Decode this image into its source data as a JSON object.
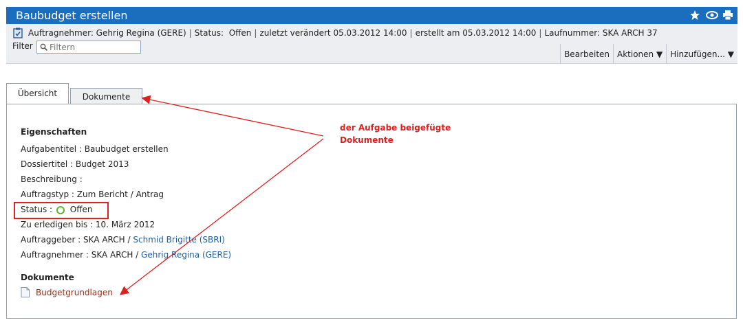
{
  "header": {
    "title": "Baubudget erstellen",
    "icons": [
      "star-icon",
      "eye-icon",
      "print-icon"
    ]
  },
  "meta": {
    "contractor": "Auftragnehmer: Gehrig Regina (GERE)",
    "status": "Status:  Offen",
    "modified": "zuletzt verändert 05.03.2012 14:00",
    "created": "erstellt am 05.03.2012 14:00",
    "number": "Laufnummer: SKA ARCH 37",
    "separator": "|"
  },
  "filter": {
    "label": "Filter",
    "placeholder": "Filtern"
  },
  "actions": [
    "Bearbeiten",
    "Aktionen ▼",
    "Hinzufügen... ▼"
  ],
  "tabs": {
    "overview": "Übersicht",
    "documents": "Dokumente"
  },
  "properties": {
    "heading": "Eigenschaften",
    "task_title": "Aufgabentitel : Baubudget erstellen",
    "dossier_title": "Dossiertitel : Budget 2013",
    "description": "Beschreibung :",
    "order_type": "Auftragstyp : Zum Bericht / Antrag",
    "status_label": "Status :",
    "status_value": "Offen",
    "due": "Zu erledigen bis : 10. März 2012",
    "issuer_prefix": "Auftraggeber : SKA ARCH /",
    "issuer_link": "Schmid Brigitte (SBRI)",
    "assignee_prefix": "Auftragnehmer : SKA ARCH /",
    "assignee_link": "Gehrig Regina (GERE)"
  },
  "documents": {
    "heading": "Dokumente",
    "items": [
      "Budgetgrundlagen"
    ]
  },
  "annotation": {
    "line1": "der Aufgabe beigefügte",
    "line2": "Dokumente",
    "color": "#e02020"
  },
  "colors": {
    "titlebar": "#1a6ebd",
    "status_ok": "#5cb531",
    "link": "#1d5f9e",
    "doc_link": "#9a2b14"
  }
}
